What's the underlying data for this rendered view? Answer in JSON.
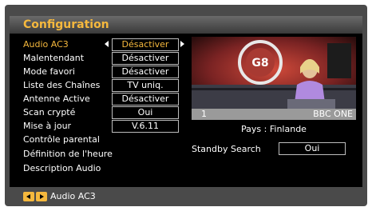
{
  "title": "Configuration",
  "menu": [
    {
      "label": "Audio AC3",
      "value": "Désactiver",
      "active": true
    },
    {
      "label": "Malentendant",
      "value": "Désactiver"
    },
    {
      "label": "Mode favori",
      "value": "Désactiver"
    },
    {
      "label": "Liste des Chaînes",
      "value": "TV uniq."
    },
    {
      "label": "Antenne Active",
      "value": "Désactiver"
    },
    {
      "label": "Scan crypté",
      "value": "Oui"
    },
    {
      "label": "Mise à jour",
      "value": "V.6.11"
    },
    {
      "label": "Contrôle parental"
    },
    {
      "label": "Définition de l'heure"
    },
    {
      "label": "Description Audio"
    }
  ],
  "preview": {
    "channel_number": "1",
    "channel_name": "BBC ONE",
    "logo_text": "G8"
  },
  "country_line": "Pays : Finlande",
  "standby": {
    "label": "Standby Search",
    "value": "Oui"
  },
  "bottom_hint": "Audio AC3",
  "colors": {
    "accent": "#f5b83d",
    "panel": "#000000",
    "frame": "#4a4a4a"
  }
}
